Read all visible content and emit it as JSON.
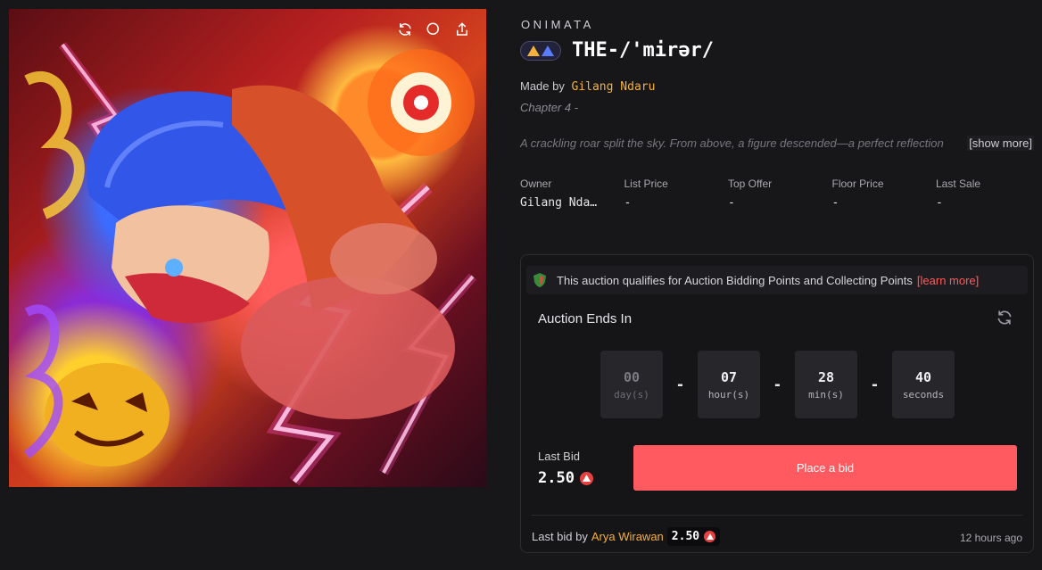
{
  "artwork": {
    "alt": "",
    "tools": [
      {
        "icon": "refresh-icon"
      },
      {
        "icon": "zoom-icon"
      },
      {
        "icon": "share-icon"
      }
    ]
  },
  "collection": "ONIMATA",
  "title": "THE-/'mirər/",
  "made_by_label": "Made by",
  "creator": "Gilang Ndaru",
  "chapter": "Chapter 4 -",
  "description": "A crackling roar split the sky. From above, a figure descended—a perfect reflection",
  "show_more": "[show more]",
  "stats": [
    {
      "label": "Owner",
      "value": "Gilang Nda…"
    },
    {
      "label": "List Price",
      "value": "-"
    },
    {
      "label": "Top Offer",
      "value": "-"
    },
    {
      "label": "Floor Price",
      "value": "-"
    },
    {
      "label": "Last Sale",
      "value": "-"
    }
  ],
  "auction": {
    "qualify_text": "This auction qualifies for Auction Bidding Points and Collecting Points",
    "learn_more": "[learn more]",
    "ends_label": "Auction Ends In",
    "countdown": [
      {
        "value": "00",
        "unit": "day(s)"
      },
      {
        "value": "07",
        "unit": "hour(s)"
      },
      {
        "value": "28",
        "unit": "min(s)"
      },
      {
        "value": "40",
        "unit": "seconds"
      }
    ],
    "separator": "-",
    "last_bid_label": "Last Bid",
    "last_bid_value": "2.50",
    "place_bid_label": "Place a bid",
    "footer_prefix": "Last bid by",
    "footer_bidder": "Arya Wirawan",
    "footer_amount": "2.50",
    "time_ago": "12 hours ago"
  },
  "colors": {
    "accent": "#ff5a60",
    "creator": "#f4b13c",
    "avax": "#e84142"
  }
}
